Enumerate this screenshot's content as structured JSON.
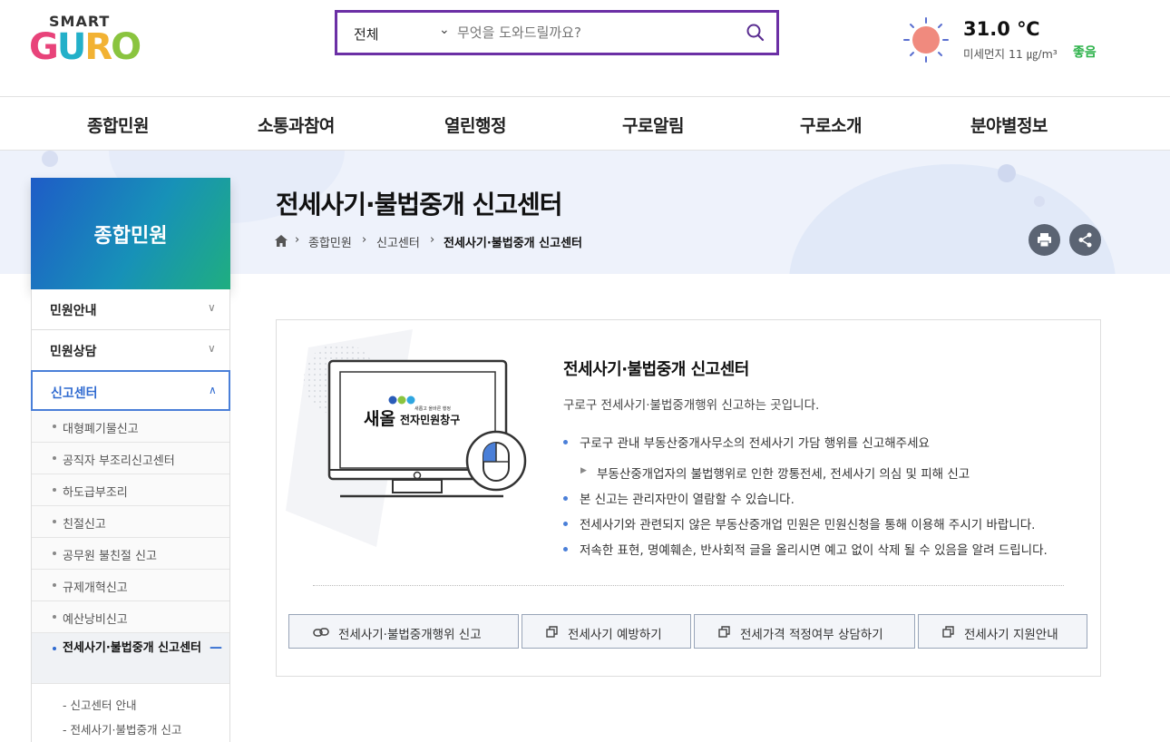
{
  "header": {
    "logo_top": "SMART",
    "logo_main": [
      "G",
      "U",
      "R",
      "O",
      ""
    ],
    "search": {
      "scope": "전체",
      "placeholder": "무엇을 도와드릴까요?"
    },
    "weather": {
      "temp": "31.0 ℃",
      "dust_label": "미세먼지 11 ㎍/m³",
      "dust_state": "좋음",
      "dust_state_color": "#2db24a"
    }
  },
  "gnb": [
    "종합민원",
    "소통과참여",
    "열린행정",
    "구로알림",
    "구로소개",
    "분야별정보"
  ],
  "page": {
    "title": "전세사기·불법중개 신고센터",
    "breadcrumb": [
      "종합민원",
      "신고센터",
      "전세사기·불법중개 신고센터"
    ]
  },
  "lnb": {
    "title": "종합민원",
    "depth1": [
      "민원안내",
      "민원상담",
      "신고센터"
    ],
    "depth2": [
      "대형폐기물신고",
      "공직자 부조리신고센터",
      "하도급부조리",
      "친절신고",
      "공무원 불친절 신고",
      "규제개혁신고",
      "예산낭비신고",
      "전세사기·불법중개 신고센터"
    ],
    "depth3": [
      "신고센터 안내",
      "전세사기·불법중개 신고"
    ]
  },
  "content": {
    "screen_logo_small": "새롭고 올바른 행정",
    "screen_logo_big": "새올",
    "screen_logo_sub": "전자민원창구",
    "title": "전세사기·불법중개 신고센터",
    "desc": "구로구 전세사기·불법중개행위 신고하는 곳입니다.",
    "bullets": [
      "구로구 관내 부동산중개사무소의 전세사기 가담 행위를 신고해주세요",
      "본 신고는 관리자만이 열람할 수 있습니다.",
      "전세사기와 관련되지 않은 부동산중개업 민원은 민원신청을 통해 이용해 주시기 바랍니다.",
      "저속한 표현, 명예훼손, 반사회적 글을 올리시면 예고 없이 삭제 될 수 있음을 알려 드립니다."
    ],
    "sub_bullet": "부동산중개업자의 불법행위로 인한 깡통전세, 전세사기 의심 및 피해 신고",
    "buttons": [
      "전세사기·불법중개행위 신고",
      "전세사기 예방하기",
      "전세가격 적정여부 상담하기",
      "전세사기 지원안내"
    ]
  },
  "colors": {
    "accent": "#2f6ad0",
    "search_border": "#6b2fa5"
  }
}
